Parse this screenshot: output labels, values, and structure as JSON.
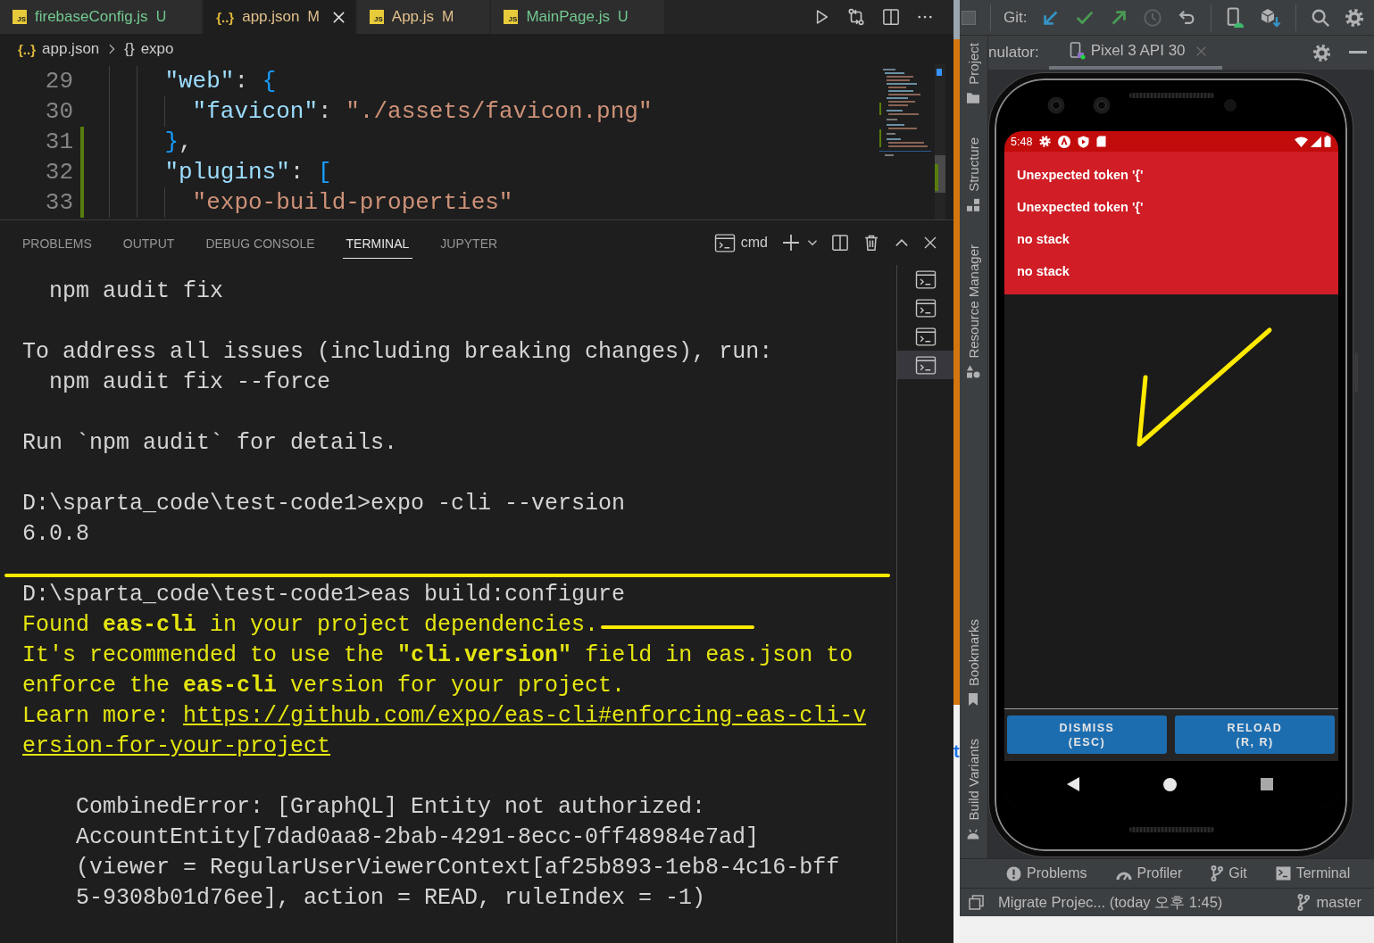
{
  "editor_tabs": [
    {
      "label": "firebaseConfig.js",
      "kind": "js",
      "icon": "JS",
      "status": "U",
      "color": "#73c991",
      "selected": false
    },
    {
      "label": "app.json",
      "kind": "json",
      "icon": "{..}",
      "status": "M",
      "color": "#e2c08d",
      "selected": true
    },
    {
      "label": "App.js",
      "kind": "js",
      "icon": "JS",
      "status": "M",
      "color": "#e2c08d",
      "selected": false
    },
    {
      "label": "MainPage.js",
      "kind": "js",
      "icon": "JS",
      "status": "U",
      "color": "#73c991",
      "selected": false
    }
  ],
  "breadcrumb": [
    {
      "kind": "file",
      "icon": "{..}",
      "label": "app.json"
    },
    {
      "kind": "object",
      "icon": "{}",
      "label": "expo"
    }
  ],
  "code_lines": [
    {
      "number": "29",
      "added": false,
      "tokens": [
        {
          "kind": "key",
          "text": "\"web\""
        },
        {
          "kind": "punct",
          "text": ":"
        },
        {
          "kind": "bracket",
          "text": "{"
        }
      ],
      "children": [
        {
          "number": "30",
          "added": false,
          "tokens": [
            {
              "kind": "key",
              "text": "\"favicon\""
            },
            {
              "kind": "punct",
              "text": ":"
            },
            {
              "kind": "string",
              "text": "\"./assets/favicon.png\""
            }
          ]
        }
      ]
    },
    {
      "number": "31",
      "added": true,
      "tokens": [
        {
          "kind": "bracket",
          "text": "}"
        },
        {
          "kind": "punct",
          "text": ","
        }
      ]
    },
    {
      "number": "32",
      "added": true,
      "tokens": [
        {
          "kind": "key",
          "text": "\"plugins\""
        },
        {
          "kind": "punct",
          "text": ":"
        },
        {
          "kind": "bracket",
          "text": "["
        }
      ],
      "children": [
        {
          "number": "33",
          "added": true,
          "tokens": [
            {
              "kind": "string",
              "text": "\"expo-build-properties\""
            }
          ]
        }
      ]
    }
  ],
  "panel_tabs": [
    {
      "label": "PROBLEMS",
      "selected": false
    },
    {
      "label": "OUTPUT",
      "selected": false
    },
    {
      "label": "DEBUG CONSOLE",
      "selected": false
    },
    {
      "label": "TERMINAL",
      "selected": true
    },
    {
      "label": "JUPYTER",
      "selected": false
    }
  ],
  "terminal_selector": {
    "label": "cmd"
  },
  "terminal_lines": [
    {
      "kind": "hint",
      "text": "npm audit fix"
    },
    {
      "kind": "blank"
    },
    {
      "kind": "plain",
      "text": "To address all issues (including breaking changes), run:"
    },
    {
      "kind": "hint",
      "text": "npm audit fix --force"
    },
    {
      "kind": "blank"
    },
    {
      "kind": "plain",
      "text": "Run `npm audit` for details."
    },
    {
      "kind": "blank"
    },
    {
      "kind": "plain",
      "text": "D:\\sparta_code\\test-code1>expo -cli --version"
    },
    {
      "kind": "plain",
      "text": "6.0.8"
    },
    {
      "kind": "blank"
    },
    {
      "kind": "plain",
      "text": "D:\\sparta_code\\test-code1>eas build:configure"
    },
    {
      "kind": "warning",
      "text": "Found **eas-cli** in your project dependencies."
    },
    {
      "kind": "warning",
      "text": "It's recommended to use the **\"cli.version\"** field in eas.json to"
    },
    {
      "kind": "warning",
      "text": "enforce the **eas-cli** version for your project."
    },
    {
      "kind": "link",
      "prefix": "Learn more:",
      "link": "https://github.com/expo/eas-cli#enforcing-eas-cli-v"
    },
    {
      "kind": "link",
      "link": "ersion-for-your-project"
    },
    {
      "kind": "blank"
    },
    {
      "kind": "error",
      "text": "CombinedError: [GraphQL] Entity not authorized:"
    },
    {
      "kind": "error",
      "text": "AccountEntity[7dad0aa8-2bab-4291-8ecc-0ff48984e7ad]"
    },
    {
      "kind": "error",
      "text": "(viewer = RegularUserViewerContext[af25b893-1eb8-4c16-bff"
    },
    {
      "kind": "error",
      "text": "5-9308b01d76ee], action = READ, ruleIndex = -1)"
    }
  ],
  "terminal_instances": [
    {
      "selected": false
    },
    {
      "selected": false
    },
    {
      "selected": false
    },
    {
      "selected": true
    }
  ],
  "background_fragment": "t",
  "android_studio": {
    "toolbar": {
      "git_label": "Git:"
    },
    "left_tools_top": [
      {
        "label": "Project"
      },
      {
        "label": "Structure"
      },
      {
        "label": "Resource Manager"
      }
    ],
    "left_tools_bottom": [
      {
        "label": "Bookmarks"
      },
      {
        "label": "Build Variants"
      }
    ],
    "emulator": {
      "title": "nulator:",
      "device_tabs": [
        {
          "label": "Pixel 3 API 30",
          "selected": true
        }
      ]
    },
    "phone": {
      "time": "5:48",
      "errors": [
        "Unexpected token '{'",
        "Unexpected token '{'",
        "no stack",
        "no stack"
      ],
      "buttons": [
        {
          "label": "DISMISS",
          "shortcut": "(ESC)"
        },
        {
          "label": "RELOAD",
          "shortcut": "(R, R)"
        }
      ]
    },
    "bottom_tools": [
      {
        "label": "Problems"
      },
      {
        "label": "Profiler"
      },
      {
        "label": "Git"
      },
      {
        "label": "Terminal"
      }
    ],
    "status_bar": {
      "message": "Migrate Projec... (today 오후 1:45)",
      "branch": "master"
    }
  }
}
